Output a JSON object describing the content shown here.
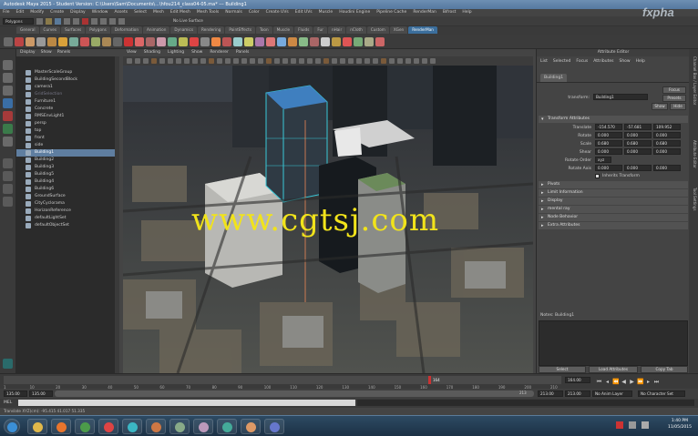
{
  "window": {
    "title": "Autodesk Maya 2015 - Student Version: C:\\Users\\Sam\\Documents\\...\\hfou214_class04-05.ma* --- Building1"
  },
  "menubar": [
    "File",
    "Edit",
    "Modify",
    "Create",
    "Display",
    "Window",
    "Assets",
    "Select",
    "Mesh",
    "Edit Mesh",
    "Mesh Tools",
    "Normals",
    "Color",
    "Create UVs",
    "Edit UVs",
    "Muscle",
    "Houdini Engine",
    "Pipeline Cache",
    "RenderMan",
    "Bifrost",
    "Help"
  ],
  "status": {
    "mode": "Polygons",
    "symmetry": "No Live Surface"
  },
  "shelf_tabs": [
    "General",
    "Curves",
    "Surfaces",
    "Polygons",
    "Deformation",
    "Animation",
    "Dynamics",
    "Rendering",
    "PaintEffects",
    "Toon",
    "Muscle",
    "Fluids",
    "Fur",
    "nHair",
    "nCloth",
    "Custom",
    "XGen",
    "RenderMan"
  ],
  "shelf_active": "RenderMan",
  "outliner": {
    "menu": [
      "Display",
      "Show",
      "Panels"
    ],
    "items": [
      {
        "label": "MasterScaleGroup",
        "state": "normal"
      },
      {
        "label": "BuildingSecondBlock",
        "state": "normal"
      },
      {
        "label": "camera1",
        "state": "normal"
      },
      {
        "label": "GridSelection",
        "state": "dim"
      },
      {
        "label": "Furniture1",
        "state": "normal"
      },
      {
        "label": "Concrete",
        "state": "normal"
      },
      {
        "label": "RMSEnvLight1",
        "state": "normal"
      },
      {
        "label": "persp",
        "state": "normal"
      },
      {
        "label": "top",
        "state": "normal"
      },
      {
        "label": "front",
        "state": "normal"
      },
      {
        "label": "side",
        "state": "normal"
      },
      {
        "label": "Building1",
        "state": "selected"
      },
      {
        "label": "Building2",
        "state": "normal"
      },
      {
        "label": "Building3",
        "state": "normal"
      },
      {
        "label": "Building5",
        "state": "normal"
      },
      {
        "label": "Building4",
        "state": "normal"
      },
      {
        "label": "Building6",
        "state": "normal"
      },
      {
        "label": "GroundSurface",
        "state": "normal"
      },
      {
        "label": "CityCyclorama",
        "state": "normal"
      },
      {
        "label": "HorizonReference",
        "state": "normal"
      },
      {
        "label": "defaultLightSet",
        "state": "normal"
      },
      {
        "label": "defaultObjectSet",
        "state": "normal"
      }
    ]
  },
  "viewport": {
    "menu": [
      "View",
      "Shading",
      "Lighting",
      "Show",
      "Renderer",
      "Panels"
    ]
  },
  "watermark": "www.cgtsj.com",
  "logo": "fxpha",
  "attribute_editor": {
    "header": "Attribute Editor",
    "menu": [
      "List",
      "Selected",
      "Focus",
      "Attributes",
      "Show",
      "Help"
    ],
    "tab": "Building1",
    "transform_label": "transform:",
    "transform_value": "Building1",
    "buttons": {
      "focus": "Focus",
      "presets": "Presets",
      "show": "Show",
      "hide": "Hide"
    },
    "sections": {
      "transform_attrs": "Transform Attributes",
      "pivots": "Pivots",
      "limit": "Limit Information",
      "display": "Display",
      "mental_ray": "mental ray",
      "node_behavior": "Node Behavior",
      "extra": "Extra Attributes"
    },
    "translate": {
      "label": "Translate",
      "x": "-154.570",
      "y": "-57.681",
      "z": "109.952"
    },
    "rotate": {
      "label": "Rotate",
      "x": "0.000",
      "y": "0.000",
      "z": "0.000"
    },
    "scale": {
      "label": "Scale",
      "x": "0.680",
      "y": "0.680",
      "z": "0.680"
    },
    "shear": {
      "label": "Shear",
      "x": "0.000",
      "y": "0.000",
      "z": "0.000"
    },
    "rotate_order": {
      "label": "Rotate Order",
      "value": "xyz"
    },
    "rotate_axis": {
      "label": "Rotate Axis",
      "x": "0.000",
      "y": "0.000",
      "z": "0.000"
    },
    "inherits": "Inherits Transform",
    "notes_label": "Notes: Building1",
    "bottom": {
      "select": "Select",
      "load": "Load Attributes",
      "copy": "Copy Tab"
    }
  },
  "side_tabs": [
    "Channel Box / Layer Editor",
    "Attribute Editor",
    "Tool Settings"
  ],
  "timeline": {
    "ticks": [
      "1",
      "10",
      "20",
      "30",
      "40",
      "50",
      "60",
      "70",
      "80",
      "90",
      "100",
      "110",
      "120",
      "130",
      "140",
      "150",
      "160",
      "170",
      "180",
      "190",
      "200",
      "210"
    ],
    "current": "164",
    "end_field": "164.00"
  },
  "range": {
    "start": "135.00",
    "start2": "135.00",
    "handle_end": "213",
    "end": "213.00",
    "end2": "213.00",
    "anim_layer": "No Anim Layer",
    "char_set": "No Character Set"
  },
  "mel_label": "MEL",
  "help_line": "Translate XYZ(cm): -95.415  41.017  51.335",
  "clock": {
    "time": "1:40 PM",
    "date": "11/05/2015"
  }
}
